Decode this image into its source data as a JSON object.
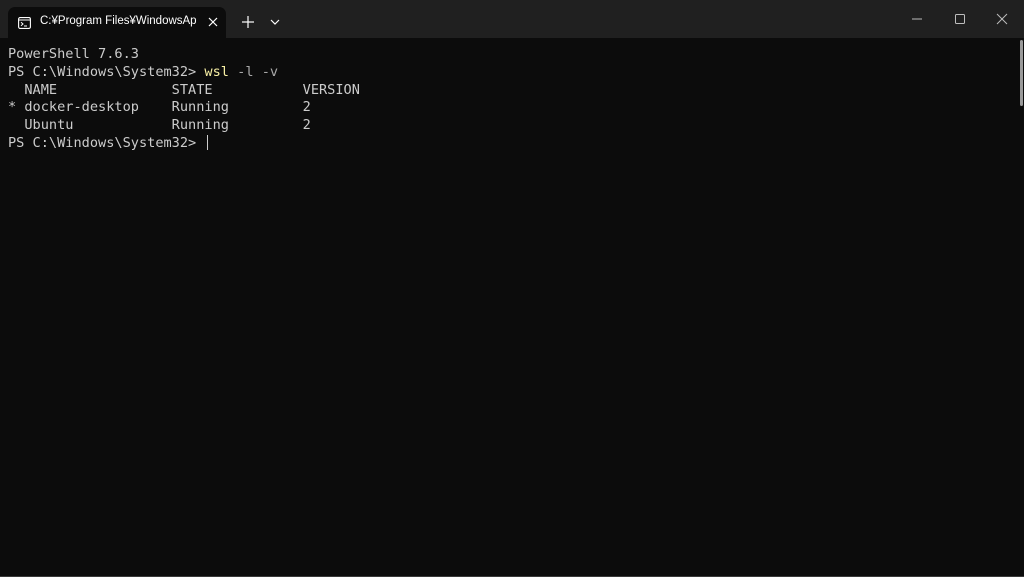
{
  "tab": {
    "title": "C:¥Program Files¥WindowsAp"
  },
  "colors": {
    "background": "#0c0c0c",
    "titlebar": "#202020",
    "text": "#cccccc",
    "command": "#f9f1a5",
    "parameter": "#a8a8a8"
  },
  "icons": {
    "tab": "terminal-icon",
    "close": "close-icon",
    "new_tab": "plus-icon",
    "dropdown": "chevron-down-icon",
    "minimize": "minimize-icon",
    "maximize": "maximize-icon",
    "window_close": "window-close-icon"
  },
  "terminal": {
    "banner": "PowerShell 7.6.3",
    "prompt": "PS C:\\Windows\\System32> ",
    "command": {
      "name": "wsl",
      "args": " -l -v"
    },
    "table_header": "  NAME              STATE           VERSION",
    "rows": [
      "* docker-desktop    Running         2",
      "  Ubuntu            Running         2"
    ],
    "final_prompt": "PS C:\\Windows\\System32> "
  }
}
